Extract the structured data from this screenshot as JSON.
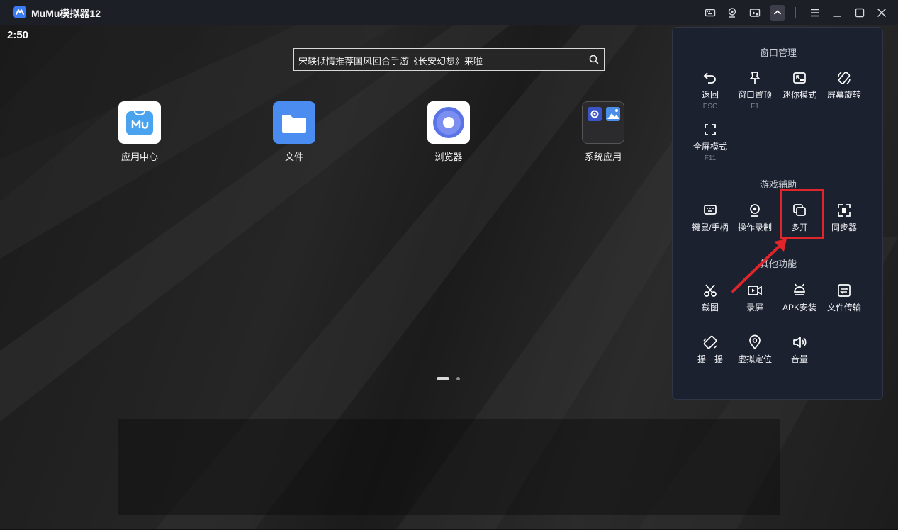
{
  "titlebar": {
    "title": "MuMu模拟器12",
    "buttons": [
      "keyboard-icon",
      "record-icon",
      "multi-window-icon",
      "chevron-up-icon",
      "menu-icon",
      "minimize-icon",
      "maximize-icon",
      "close-icon"
    ]
  },
  "statusbar": {
    "time": "2:50"
  },
  "search": {
    "text": "宋轶倾情推荐国风回合手游《长安幻想》来啦"
  },
  "apps": [
    {
      "label": "应用中心",
      "icon": "app-center-icon"
    },
    {
      "label": "文件",
      "icon": "folder-icon"
    },
    {
      "label": "浏览器",
      "icon": "browser-icon"
    },
    {
      "label": "系统应用",
      "icon": "system-apps-icon"
    }
  ],
  "panel": {
    "window_section": "窗口管理",
    "window_tools": [
      {
        "label": "返回",
        "key": "ESC"
      },
      {
        "label": "窗口置顶",
        "key": "F1"
      },
      {
        "label": "迷你模式",
        "key": ""
      },
      {
        "label": "屏幕旋转",
        "key": ""
      },
      {
        "label": "全屏模式",
        "key": "F11"
      }
    ],
    "game_section": "游戏辅助",
    "game_tools": [
      {
        "label": "键鼠/手柄"
      },
      {
        "label": "操作录制"
      },
      {
        "label": "多开"
      },
      {
        "label": "同步器"
      }
    ],
    "other_section": "其他功能",
    "other_tools": [
      {
        "label": "截图"
      },
      {
        "label": "录屏"
      },
      {
        "label": "APK安装"
      },
      {
        "label": "文件传输"
      },
      {
        "label": "摇一摇"
      },
      {
        "label": "虚拟定位"
      },
      {
        "label": "音量"
      }
    ]
  },
  "colors": {
    "accent": "#3b7cf5",
    "highlight": "#e0252b",
    "panel_bg": "#1c2130"
  }
}
